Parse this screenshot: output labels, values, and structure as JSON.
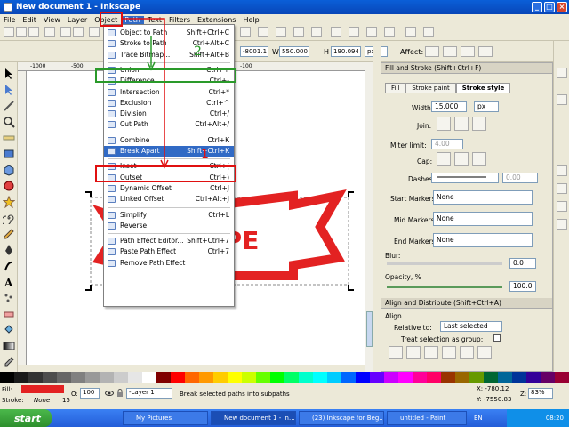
{
  "window": {
    "title": "New document 1 - Inkscape"
  },
  "menubar": [
    "File",
    "Edit",
    "View",
    "Layer",
    "Object",
    "Path",
    "Text",
    "Filters",
    "Extensions",
    "Help"
  ],
  "path_menu": [
    {
      "label": "Object to Path",
      "shortcut": "Shift+Ctrl+C"
    },
    {
      "label": "Stroke to Path",
      "shortcut": "Ctrl+Alt+C"
    },
    {
      "label": "Trace Bitmap...",
      "shortcut": "Shift+Alt+B"
    },
    {
      "sep": true
    },
    {
      "label": "Union",
      "shortcut": "Ctrl++"
    },
    {
      "label": "Difference",
      "shortcut": "Ctrl+-"
    },
    {
      "label": "Intersection",
      "shortcut": "Ctrl+*"
    },
    {
      "label": "Exclusion",
      "shortcut": "Ctrl+^"
    },
    {
      "label": "Division",
      "shortcut": "Ctrl+/"
    },
    {
      "label": "Cut Path",
      "shortcut": "Ctrl+Alt+/"
    },
    {
      "sep": true
    },
    {
      "label": "Combine",
      "shortcut": "Ctrl+K"
    },
    {
      "label": "Break Apart",
      "shortcut": "Shift+Ctrl+K"
    },
    {
      "sep": true
    },
    {
      "label": "Inset",
      "shortcut": "Ctrl+("
    },
    {
      "label": "Outset",
      "shortcut": "Ctrl+)"
    },
    {
      "label": "Dynamic Offset",
      "shortcut": "Ctrl+J"
    },
    {
      "label": "Linked Offset",
      "shortcut": "Ctrl+Alt+J"
    },
    {
      "sep": true
    },
    {
      "label": "Simplify",
      "shortcut": "Ctrl+L"
    },
    {
      "label": "Reverse",
      "shortcut": ""
    },
    {
      "sep": true
    },
    {
      "label": "Path Effect Editor...",
      "shortcut": "Shift+Ctrl+7"
    },
    {
      "label": "Paste Path Effect",
      "shortcut": "Ctrl+7"
    },
    {
      "label": "Remove Path Effect",
      "shortcut": ""
    }
  ],
  "annotations": {
    "num1": "1",
    "num2": "2"
  },
  "toolbar2": {
    "x": "-8001.1",
    "w_label": "W",
    "w": "550.000",
    "h_label": "H",
    "h": "190.094",
    "unit": "px",
    "affect": "Affect:"
  },
  "canvas": {
    "logo_text": "APE",
    "ruler_marks": [
      "-1000",
      "-500",
      "-100"
    ]
  },
  "fill_stroke": {
    "header": "Fill and Stroke (Shift+Ctrl+F)",
    "tabs": [
      "Fill",
      "Stroke paint",
      "Stroke style"
    ],
    "width_label": "Width:",
    "width": "15.000",
    "width_unit": "px",
    "join_label": "Join:",
    "miter_label": "Miter limit:",
    "miter": "4.00",
    "cap_label": "Cap:",
    "dashes_label": "Dashes:",
    "dashes_val": "0.00",
    "start_label": "Start Markers:",
    "start": "None",
    "mid_label": "Mid Markers:",
    "mid": "None",
    "end_label": "End Markers:",
    "end": "None",
    "blur_label": "Blur:",
    "blur": "0.0",
    "opacity_label": "Opacity, %",
    "opacity": "100.0"
  },
  "align": {
    "header": "Align and Distribute (Shift+Ctrl+A)",
    "section": "Align",
    "relative_label": "Relative to:",
    "relative": "Last selected",
    "treat_label": "Treat selection as group:"
  },
  "status": {
    "fill_label": "Fill:",
    "stroke_label": "Stroke:",
    "stroke_val": "None",
    "stroke_num": "15",
    "o_label": "O:",
    "opacity": "100",
    "layer": "-Layer 1",
    "message": "Break selected paths into subpaths",
    "x": "X:  -780.12",
    "y": "Y: -7550.83",
    "z_label": "Z:",
    "zoom": "83%"
  },
  "taskbar": {
    "start": "start",
    "tasks": [
      "My Pictures",
      "New document 1 - In...",
      "(23) Inkscape for Beg...",
      "untitled - Paint"
    ],
    "lang": "EN",
    "time": "08:20"
  },
  "palette": [
    "#000000",
    "#1a1a1a",
    "#333333",
    "#4d4d4d",
    "#666666",
    "#808080",
    "#999999",
    "#b3b3b3",
    "#cccccc",
    "#e6e6e6",
    "#ffffff",
    "#800000",
    "#ff0000",
    "#ff6600",
    "#ff9900",
    "#ffcc00",
    "#ffff00",
    "#ccff00",
    "#66ff00",
    "#00ff00",
    "#00ff66",
    "#00ffcc",
    "#00ffff",
    "#00ccff",
    "#0066ff",
    "#0000ff",
    "#6600ff",
    "#cc00ff",
    "#ff00ff",
    "#ff0099",
    "#ff0066",
    "#993300",
    "#996600",
    "#669900",
    "#006633",
    "#006699",
    "#003399",
    "#330099",
    "#660066",
    "#990033"
  ],
  "colors": {
    "accent": "#316ac5",
    "red_marker": "#e01010",
    "green_marker": "#2a9a2a",
    "logo_red": "#e32222"
  }
}
